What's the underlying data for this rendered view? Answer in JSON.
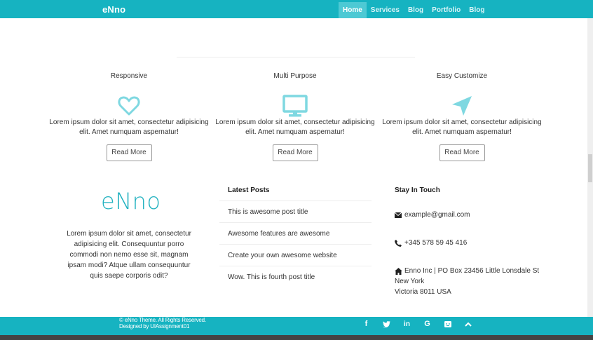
{
  "header": {
    "brand": "eNno",
    "nav": [
      {
        "label": "Home",
        "active": true
      },
      {
        "label": "Services",
        "active": false
      },
      {
        "label": "Blog",
        "active": false
      },
      {
        "label": "Portfolio",
        "active": false
      },
      {
        "label": "Blog",
        "active": false
      }
    ]
  },
  "features": [
    {
      "title": "Responsive",
      "icon": "heart-icon",
      "text": "Lorem ipsum dolor sit amet, consectetur adipisicing elit. Amet numquam aspernatur!",
      "button": "Read More"
    },
    {
      "title": "Multi Purpose",
      "icon": "monitor-icon",
      "text": "Lorem ipsum dolor sit amet, consectetur adipisicing elit. Amet numquam aspernatur!",
      "button": "Read More"
    },
    {
      "title": "Easy Customize",
      "icon": "paper-plane-icon",
      "text": "Lorem ipsum dolor sit amet, consectetur adipisicing elit. Amet numquam aspernatur!",
      "button": "Read More"
    }
  ],
  "footer_about": {
    "logo": "eNno",
    "text": "Lorem ipsum dolor sit amet, consectetur adipisicing elit. Consequuntur porro commodi non nemo esse sit, magnam ipsam modi? Atque ullam consequuntur quis saepe corporis odit?"
  },
  "latest_posts": {
    "title": "Latest Posts",
    "items": [
      "This is awesome post title",
      "Awesome features are awesome",
      "Create your own awesome website",
      "Wow. This is fourth post title"
    ]
  },
  "stay_in_touch": {
    "title": "Stay In Touch",
    "email": "example@gmail.com",
    "phone": "+345 578 59 45 416",
    "address_line1": "Enno Inc | PO Box 23456 Little Lonsdale St",
    "address_line2": "New York",
    "address_line3": "Victoria 8011 USA"
  },
  "footer": {
    "copyright": "© eNno Theme. All Rights Reserved.",
    "designed_by": "Designed by UIAssignment01",
    "social": [
      "facebook-icon",
      "twitter-icon",
      "linkedin-icon",
      "google-icon",
      "chat-icon",
      "scroll-up-icon"
    ]
  },
  "colors": {
    "accent": "#16b3c1",
    "accent_icon": "#7fd8e1",
    "logo": "#23b2c0"
  }
}
